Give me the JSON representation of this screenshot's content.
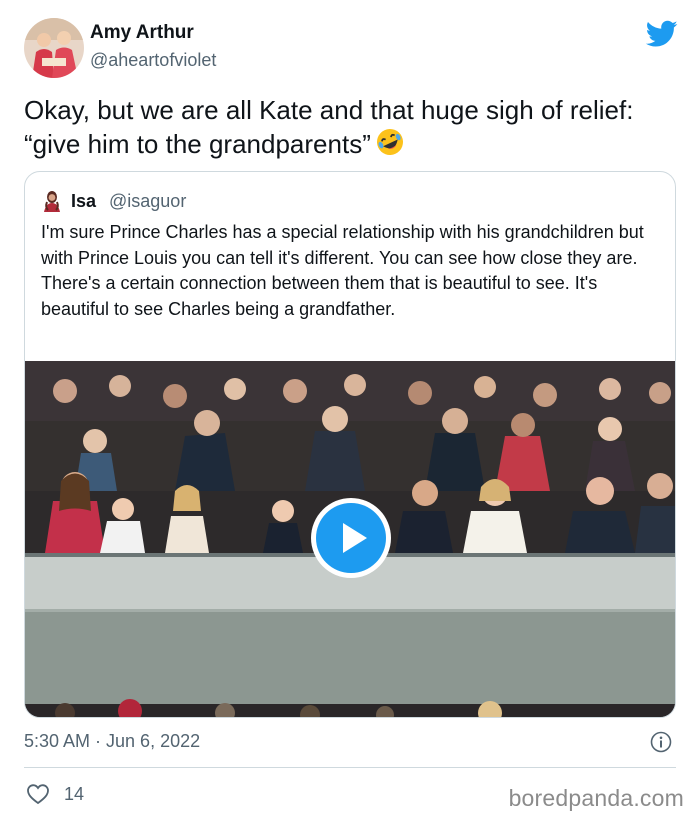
{
  "author": {
    "display_name": "Amy Arthur",
    "handle": "@aheartofviolet",
    "avatar_icon": "profile-photo",
    "platform_icon": "twitter-bird-icon"
  },
  "tweet": {
    "text": "Okay, but we are all Kate and that huge sigh of relief: “give him to the grandparents”",
    "emoji": "rolling-on-floor-laughing-emoji"
  },
  "quoted_tweet": {
    "display_name": "Isa",
    "handle": "@isaguor",
    "text": "I'm sure Prince Charles has a special relationship with his grandchildren but with Prince Louis you can tell it's different. You can see how close they are. There's a certain connection between them that is beautiful to see. It's beautiful to see Charles being a grandfather.",
    "media_type": "video"
  },
  "meta": {
    "timestamp": "5:30 AM · Jun 6, 2022",
    "likes": "14"
  },
  "watermark": "boredpanda.com",
  "colors": {
    "brand": "#1d9bf0",
    "text": "#0f1419",
    "muted": "#536471",
    "border": "#cfd9de"
  }
}
